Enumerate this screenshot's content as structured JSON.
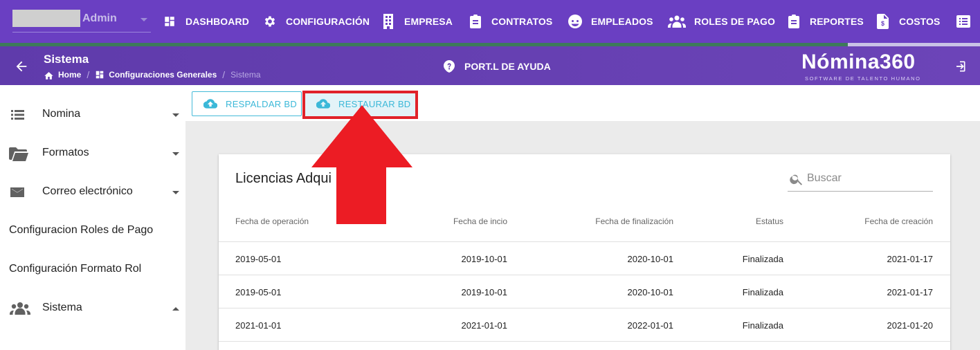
{
  "topbar": {
    "user_name": "Admin",
    "nav": [
      {
        "label": "DASHBOARD",
        "icon": "dashboard-icon"
      },
      {
        "label": "CONFIGURACIÓN",
        "icon": "gear-icon"
      },
      {
        "label": "EMPRESA",
        "icon": "building-icon"
      },
      {
        "label": "CONTRATOS",
        "icon": "clipboard-icon"
      },
      {
        "label": "EMPLEADOS",
        "icon": "face-icon"
      },
      {
        "label": "ROLES DE PAGO",
        "icon": "people-icon"
      },
      {
        "label": "REPORTES",
        "icon": "clipboard-list-icon"
      },
      {
        "label": "COSTOS",
        "icon": "invoice-icon"
      }
    ]
  },
  "header": {
    "title": "Sistema",
    "breadcrumb": [
      "Home",
      "Configuraciones Generales",
      "Sistema"
    ],
    "help_label": "PORT.L DE AYUDA",
    "brand": "Nómina360",
    "brand_tagline": "SOFTWARE DE TALENTO HUMANO"
  },
  "sidebar": {
    "items": [
      {
        "label": "Nomina",
        "icon": "list-icon"
      },
      {
        "label": "Formatos",
        "icon": "folder-icon"
      },
      {
        "label": "Correo electrónico",
        "icon": "mail-icon"
      },
      {
        "label": "Configuracion Roles de Pago"
      },
      {
        "label": "Configuración Formato Rol"
      },
      {
        "label": "Sistema",
        "icon": "people-icon"
      }
    ]
  },
  "toolbar": {
    "backup_label": "RESPALDAR BD",
    "restore_label": "RESTAURAR BD"
  },
  "card": {
    "title": "Licencias Adqui",
    "search_placeholder": "Buscar",
    "columns": [
      "Fecha de operación",
      "Fecha de incio",
      "Fecha de finalización",
      "Estatus",
      "Fecha de creación"
    ],
    "rows": [
      [
        "2019-05-01",
        "2019-10-01",
        "2020-10-01",
        "Finalizada",
        "2021-01-17"
      ],
      [
        "2019-05-01",
        "2019-10-01",
        "2020-10-01",
        "Finalizada",
        "2021-01-17"
      ],
      [
        "2021-01-01",
        "2021-01-01",
        "2022-01-01",
        "Finalizada",
        "2021-01-20"
      ]
    ]
  },
  "colors": {
    "topbar": "#6a3fc2",
    "accent": "#3bb8d8",
    "annotation": "#e0232a"
  }
}
